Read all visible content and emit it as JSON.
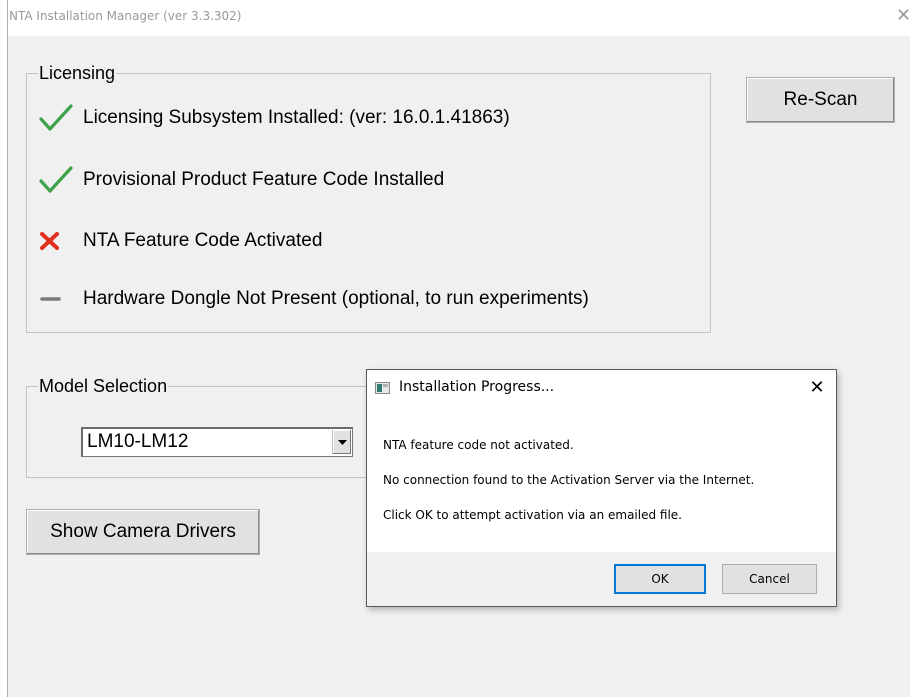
{
  "window": {
    "title": "NTA Installation Manager (ver 3.3.302)",
    "close_glyph": "✕"
  },
  "licensing": {
    "legend": "Licensing",
    "items": [
      {
        "status": "ok",
        "icon": "check-icon",
        "color": "#3ca34a",
        "label": "Licensing Subsystem Installed: (ver: 16.0.1.41863)"
      },
      {
        "status": "ok",
        "icon": "check-icon",
        "color": "#3ca34a",
        "label": "Provisional Product Feature Code Installed"
      },
      {
        "status": "fail",
        "icon": "cross-icon",
        "color": "#e0301e",
        "label": "NTA Feature Code Activated"
      },
      {
        "status": "absent",
        "icon": "dash-icon",
        "color": "#7a7a7a",
        "label": "Hardware Dongle Not Present (optional, to run experiments)"
      }
    ]
  },
  "rescan_button": {
    "label": "Re-Scan"
  },
  "model_selection": {
    "legend": "Model Selection",
    "selected": "LM10-LM12"
  },
  "camera_button": {
    "label": "Show Camera Drivers"
  },
  "dialog": {
    "title": "Installation Progress...",
    "close_glyph": "✕",
    "lines": [
      "NTA feature code not activated.",
      "No connection found to the Activation Server via the Internet.",
      "Click OK to attempt activation via an emailed file."
    ],
    "ok_label": "OK",
    "cancel_label": "Cancel",
    "accent": "#0078d7"
  }
}
